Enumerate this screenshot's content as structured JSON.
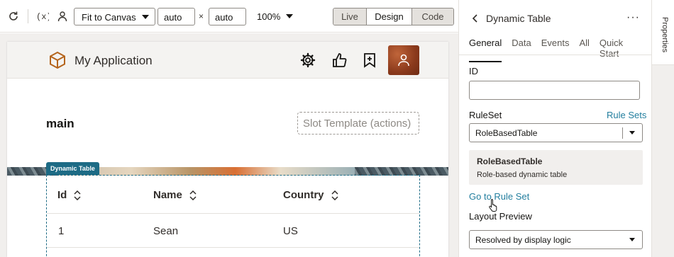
{
  "toolbar": {
    "fit_label": "Fit to Canvas",
    "width_value": "auto",
    "times": "×",
    "height_value": "auto",
    "zoom": "100%",
    "modes": {
      "live": "Live",
      "design": "Design",
      "code": "Code"
    },
    "active_mode": "Design"
  },
  "app": {
    "title": "My Application",
    "page_name": "main",
    "slot_template": "Slot Template (actions)",
    "component_badge": "Dynamic Table",
    "table": {
      "columns": [
        "Id",
        "Name",
        "Country"
      ],
      "rows": [
        [
          "1",
          "Sean",
          "US"
        ]
      ]
    }
  },
  "panel": {
    "title": "Dynamic Table",
    "more": "···",
    "tabs": [
      "General",
      "Data",
      "Events",
      "All",
      "Quick Start"
    ],
    "active_tab": "General",
    "id_label": "ID",
    "id_value": "",
    "ruleset_label": "RuleSet",
    "rulesets_link": "Rule Sets",
    "ruleset_value": "RoleBasedTable",
    "card_title": "RoleBasedTable",
    "card_desc": "Role-based dynamic table",
    "goto_link": "Go to Rule Set",
    "layout_label": "Layout Preview",
    "layout_value": "Resolved by display logic"
  },
  "side_tab": {
    "label": "Properties"
  },
  "colors": {
    "accent": "#227e9e",
    "badge": "#1d6b85"
  }
}
